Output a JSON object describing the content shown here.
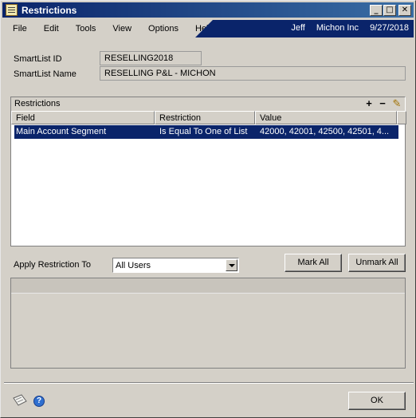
{
  "window": {
    "title": "Restrictions"
  },
  "title_buttons": {
    "minimize": "_",
    "maximize": "□",
    "close": "✕"
  },
  "menu": {
    "items": [
      "File",
      "Edit",
      "Tools",
      "View",
      "Options",
      "Help"
    ],
    "user": "Jeff",
    "company": "Michon Inc",
    "date": "9/27/2018"
  },
  "smartlist": {
    "id_label": "SmartList ID",
    "id_value": "RESELLING2018",
    "name_label": "SmartList Name",
    "name_value": "RESELLING P&L - MICHON"
  },
  "restrictions": {
    "group_label": "Restrictions",
    "add_icon": "+",
    "remove_icon": "−",
    "edit_icon": "✎",
    "columns": [
      "Field",
      "Restriction",
      "Value"
    ],
    "rows": [
      {
        "field": "Main Account Segment",
        "restriction": "Is Equal To One of List",
        "value": "42000, 42001, 42500, 42501, 4..."
      }
    ]
  },
  "apply": {
    "label": "Apply Restriction To",
    "selected": "All Users"
  },
  "buttons": {
    "mark_all": "Mark All",
    "unmark_all": "Unmark All",
    "ok": "OK"
  },
  "help_glyph": "?",
  "icons": [
    "note-icon",
    "help-icon",
    "add-icon",
    "remove-icon",
    "edit-pencil-icon",
    "window-icon"
  ],
  "colors": {
    "title_bar": "#0a246a",
    "selection": "#0a246a",
    "face": "#d4d0c8"
  }
}
